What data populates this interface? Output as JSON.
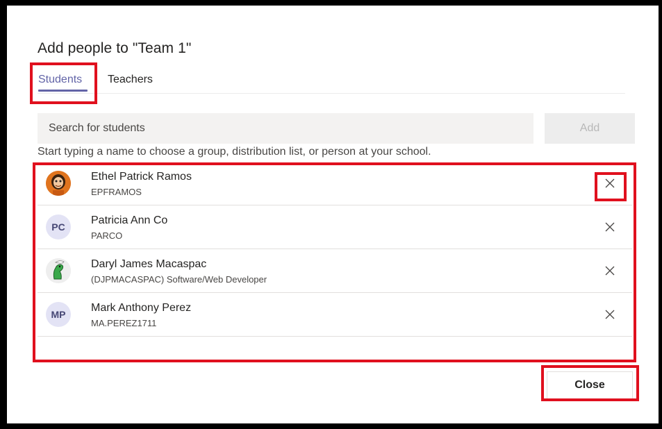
{
  "dialog": {
    "title": "Add people to \"Team 1\"",
    "tabs": [
      {
        "label": "Students",
        "active": true
      },
      {
        "label": "Teachers",
        "active": false
      }
    ],
    "search": {
      "placeholder": "Search for students",
      "value": ""
    },
    "add_label": "Add",
    "hint": "Start typing a name to choose a group, distribution list, or person at your school.",
    "people": [
      {
        "name": "Ethel Patrick Ramos",
        "sub": "EPFRAMOS",
        "avatar": "photo",
        "initials": ""
      },
      {
        "name": "Patricia Ann Co",
        "sub": "PARCO",
        "avatar": "initials",
        "initials": "PC"
      },
      {
        "name": "Daryl James Macaspac",
        "sub": "(DJPMACASPAC) Software/Web Developer",
        "avatar": "photo",
        "initials": ""
      },
      {
        "name": "Mark Anthony Perez",
        "sub": "MA.PEREZ1711",
        "avatar": "initials",
        "initials": "MP"
      }
    ],
    "close_label": "Close"
  },
  "colors": {
    "accent": "#6264a7",
    "highlight": "#e0101e",
    "avatar_bg": "#e3e3f5"
  }
}
